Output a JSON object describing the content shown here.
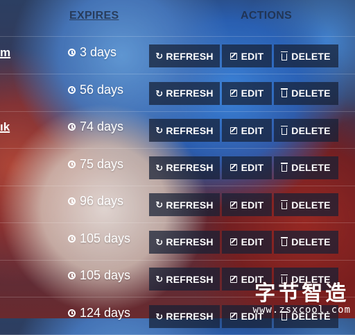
{
  "header": {
    "expires_label": "EXPIRES",
    "actions_label": "ACTIONS"
  },
  "rows": [
    {
      "domain_fragment": "m",
      "expires": "3 days"
    },
    {
      "domain_fragment": "",
      "expires": "56 days"
    },
    {
      "domain_fragment": "ık",
      "expires": "74 days"
    },
    {
      "domain_fragment": "",
      "expires": "75 days"
    },
    {
      "domain_fragment": "",
      "expires": "96 days"
    },
    {
      "domain_fragment": "",
      "expires": "105 days"
    },
    {
      "domain_fragment": "",
      "expires": "105 days"
    },
    {
      "domain_fragment": "",
      "expires": "124 days"
    }
  ],
  "actions": {
    "refresh_label": "REFRESH",
    "edit_label": "EDIT",
    "delete_label": "DELETE"
  },
  "icons": {
    "expires": "clock-icon",
    "refresh": "refresh-icon",
    "edit": "edit-icon",
    "delete": "trash-icon"
  },
  "watermark": {
    "text": "字节智造",
    "url": "www.zsxcool.com"
  }
}
